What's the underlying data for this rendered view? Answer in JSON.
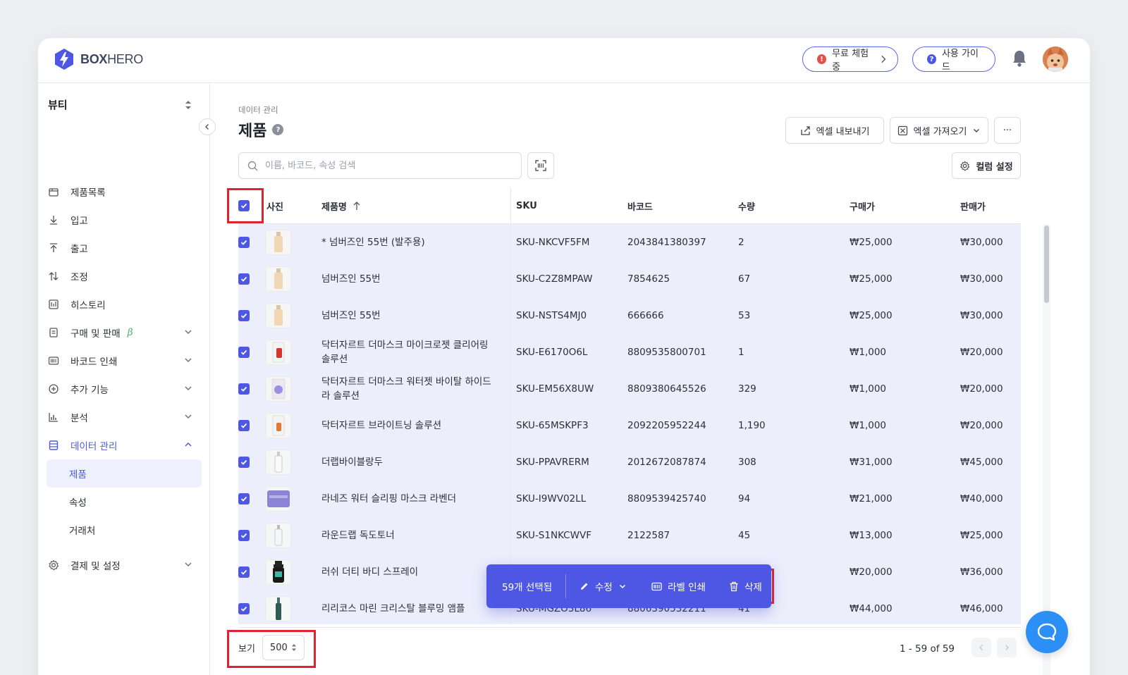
{
  "brand": {
    "logo_bold": "BOX",
    "logo_light": "HERO"
  },
  "header": {
    "trial_label": "무료 체험중",
    "trial_badge": "!",
    "guide_label": "사용 가이드",
    "guide_badge": "?"
  },
  "sidebar": {
    "workspace": "뷰티",
    "items": [
      {
        "label": "제품목록",
        "icon": "box-icon"
      },
      {
        "label": "입고",
        "icon": "arrow-down-icon"
      },
      {
        "label": "출고",
        "icon": "arrow-up-icon"
      },
      {
        "label": "조정",
        "icon": "swap-icon"
      },
      {
        "label": "히스토리",
        "icon": "history-icon"
      },
      {
        "label": "구매 및 판매",
        "icon": "document-icon",
        "beta": "β"
      },
      {
        "label": "바코드 인쇄",
        "icon": "barcode-icon"
      },
      {
        "label": "추가 기능",
        "icon": "plus-circle-icon"
      },
      {
        "label": "분석",
        "icon": "chart-icon"
      },
      {
        "label": "데이터 관리",
        "icon": "database-icon"
      }
    ],
    "sub_items": [
      "제품",
      "속성",
      "거래처"
    ],
    "settings": {
      "label": "결제 및 설정",
      "icon": "gear-icon"
    }
  },
  "page": {
    "breadcrumb": "데이터 관리",
    "title": "제품",
    "help": "?",
    "export_label": "엑셀 내보내기",
    "import_label": "엑셀 가져오기",
    "more_label": "···",
    "search_placeholder": "이름, 바코드, 속성 검색",
    "columns_label": "컬럼 설정"
  },
  "table": {
    "headers": {
      "photo": "사진",
      "name": "제품명",
      "sku": "SKU",
      "barcode": "바코드",
      "qty": "수량",
      "buy": "구매가",
      "sell": "판매가"
    },
    "rows": [
      {
        "name": "* 넘버즈인 55번 (발주용)",
        "sku": "SKU-NKCVF5FM",
        "barcode": "2043841380397",
        "qty": "2",
        "buy": "₩25,000",
        "sell": "₩30,000",
        "thumb": "beige-bottle"
      },
      {
        "name": "넘버즈인 55번",
        "sku": "SKU-C2Z8MPAW",
        "barcode": "7854625",
        "qty": "67",
        "buy": "₩25,000",
        "sell": "₩30,000",
        "thumb": "beige-bottle"
      },
      {
        "name": "넘버즈인 55번",
        "sku": "SKU-NSTS4MJ0",
        "barcode": "666666",
        "qty": "53",
        "buy": "₩25,000",
        "sell": "₩30,000",
        "thumb": "beige-bottle"
      },
      {
        "name": "닥터자르트 더마스크 마이크로젯 클리어링 솔루션",
        "sku": "SKU-E6170O6L",
        "barcode": "8809535800701",
        "qty": "1",
        "buy": "₩1,000",
        "sell": "₩20,000",
        "thumb": "red-pack"
      },
      {
        "name": "닥터자르트 더마스크 워터젯 바이탈 하이드라 솔루션",
        "sku": "SKU-EM56X8UW",
        "barcode": "8809380645526",
        "qty": "329",
        "buy": "₩1,000",
        "sell": "₩20,000",
        "thumb": "purple-pack"
      },
      {
        "name": "닥터자르트 브라이트닝 솔루션",
        "sku": "SKU-65MSKPF3",
        "barcode": "2092205952244",
        "qty": "1,190",
        "buy": "₩1,000",
        "sell": "₩20,000",
        "thumb": "orange-pack"
      },
      {
        "name": "더랩바이블랑두",
        "sku": "SKU-PPAVRERM",
        "barcode": "2012672087874",
        "qty": "308",
        "buy": "₩31,000",
        "sell": "₩45,000",
        "thumb": "white-bottle"
      },
      {
        "name": "라네즈 워터 슬리핑 마스크 라벤더",
        "sku": "SKU-I9WV02LL",
        "barcode": "8809539425740",
        "qty": "94",
        "buy": "₩21,000",
        "sell": "₩40,000",
        "thumb": "lavender-jar"
      },
      {
        "name": "라운드랩 독도토너",
        "sku": "SKU-S1NKCWVF",
        "barcode": "2122587",
        "qty": "45",
        "buy": "₩13,000",
        "sell": "₩25,000",
        "thumb": "clear-bottle"
      },
      {
        "name": "러쉬 더티 바디 스프레이",
        "sku": "",
        "barcode": "",
        "qty": "",
        "buy": "₩20,000",
        "sell": "₩36,000",
        "thumb": "black-spray"
      },
      {
        "name": "리리코스 마린 크리스탈 블루밍 앰플",
        "sku": "SKU-MGZO3L86",
        "barcode": "8806390532211",
        "qty": "41",
        "buy": "₩44,000",
        "sell": "₩46,000",
        "thumb": "green-ampoule"
      }
    ]
  },
  "footer": {
    "view_label": "보기",
    "page_size": "500",
    "range": "1 - 59 of 59"
  },
  "action_bar": {
    "selected": "59개 선택됨",
    "edit": "수정",
    "print_label": "라벨 인쇄",
    "delete": "삭제"
  },
  "colors": {
    "accent": "#4d57e3",
    "highlight": "#e0242f",
    "row_selected": "#eceefc",
    "chat": "#2b8ff5"
  }
}
